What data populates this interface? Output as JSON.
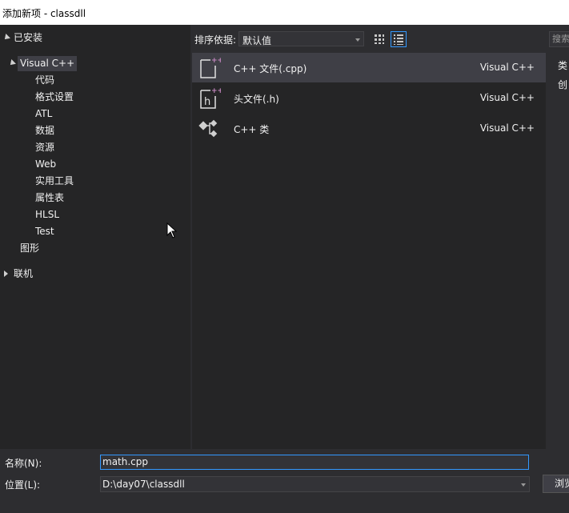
{
  "window": {
    "title": "添加新项 - classdll"
  },
  "tree": {
    "installed": "已安装",
    "visual_cpp": "Visual C++",
    "children": [
      "代码",
      "格式设置",
      "ATL",
      "数据",
      "资源",
      "Web",
      "实用工具",
      "属性表",
      "HLSL",
      "Test"
    ],
    "graphics": "图形",
    "online": "联机"
  },
  "toolbar": {
    "sort_label": "排序依据:",
    "sort_value": "默认值",
    "grid_view_icon": "grid-view-icon",
    "list_view_icon": "list-view-icon"
  },
  "templates": [
    {
      "name": "C++ 文件(.cpp)",
      "type": "Visual C++",
      "icon": "cpp-file-icon",
      "selected": true
    },
    {
      "name": "头文件(.h)",
      "type": "Visual C++",
      "icon": "header-file-icon",
      "selected": false
    },
    {
      "name": "C++ 类",
      "type": "Visual C++",
      "icon": "cpp-class-icon",
      "selected": false
    }
  ],
  "right_panel": {
    "search_placeholder": "搜索",
    "type_label": "类",
    "desc": "创"
  },
  "form": {
    "name_label": "名称(N):",
    "name_value": "math.cpp",
    "location_label": "位置(L):",
    "location_value": "D:\\day07\\classdll",
    "browse_label": "浏览"
  },
  "colors": {
    "background": "#2d2d30",
    "panel": "#252526",
    "selection": "#3f3f46",
    "accent": "#3399ff",
    "icon_pink": "#c586c0"
  }
}
